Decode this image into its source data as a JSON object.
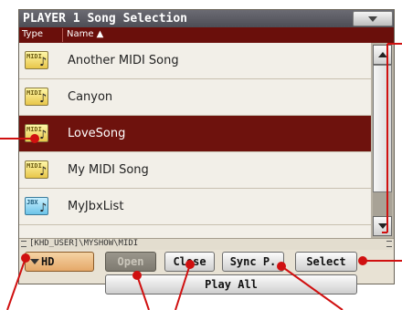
{
  "title": "PLAYER 1 Song Selection",
  "columns": {
    "type": "Type",
    "name": "Name ▲"
  },
  "files": [
    {
      "icon_label": "MIDI",
      "name": "Another MIDI Song",
      "selected": false
    },
    {
      "icon_label": "MIDI",
      "name": "Canyon",
      "selected": false
    },
    {
      "icon_label": "MIDI",
      "name": "LoveSong",
      "selected": true
    },
    {
      "icon_label": "MIDI",
      "name": "My MIDI Song",
      "selected": false
    },
    {
      "icon_label": "JBX",
      "name": "MyJbxList",
      "selected": false
    }
  ],
  "path": "[KHD_USER]\\MYSHOW\\MIDI",
  "device": "HD",
  "buttons": {
    "open": "Open",
    "close": "Close",
    "sync": "Sync P.",
    "select": "Select",
    "play_all": "Play All"
  },
  "colors": {
    "header_bg": "#6a0f0b",
    "selected_row": "#6e120d",
    "callout_line": "#d01010",
    "panel_bg": "#e8e2d4"
  },
  "icons": {
    "menu": "triangle-down-icon",
    "midi_file": "midi-file-icon",
    "jbx_file": "jbx-file-icon",
    "scroll_up": "arrow-up-icon",
    "scroll_down": "arrow-down-icon"
  }
}
